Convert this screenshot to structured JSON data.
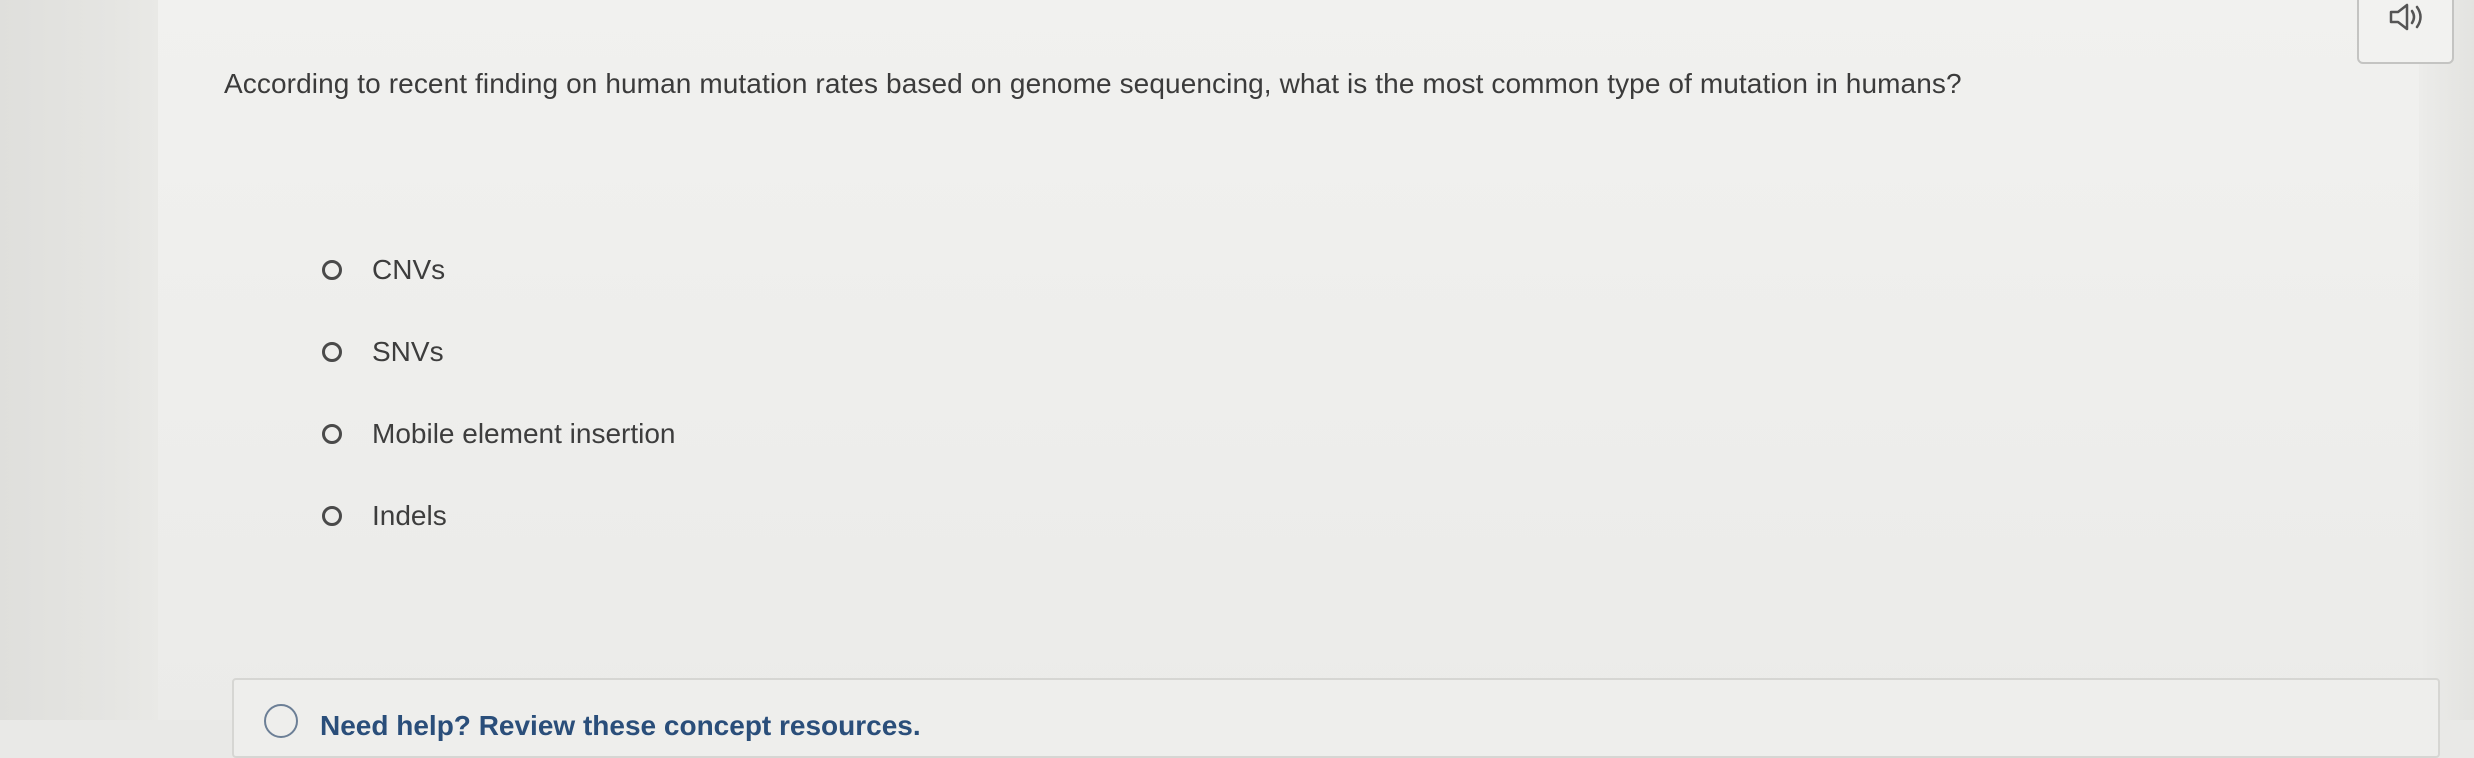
{
  "question": {
    "text": "According to recent finding on human mutation rates based on genome sequencing, what is the most common type of mutation in humans?"
  },
  "options": [
    {
      "label": "CNVs"
    },
    {
      "label": "SNVs"
    },
    {
      "label": "Mobile element insertion"
    },
    {
      "label": "Indels"
    }
  ],
  "audio_button": {
    "icon": "speaker-icon"
  },
  "help": {
    "text": "Need help? Review these concept resources.",
    "icon": "help-circle-icon"
  }
}
